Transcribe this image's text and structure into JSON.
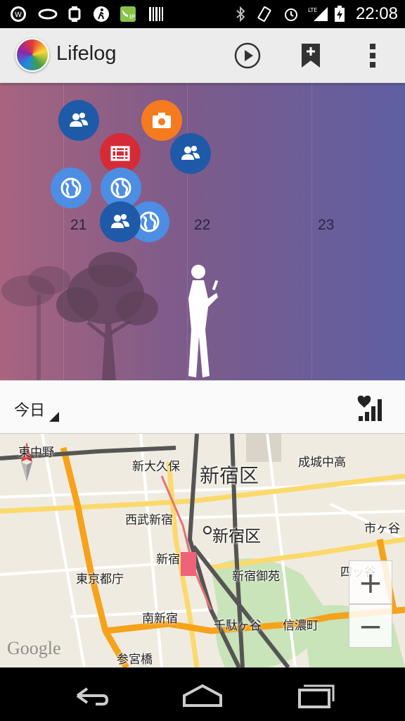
{
  "status_bar": {
    "time": "22:08",
    "left_icons": [
      "w-badge-icon",
      "wristband-icon",
      "smartwatch-icon",
      "walking-person-icon",
      "ip-phone-icon",
      "barcode-icon"
    ],
    "right_icons": [
      "bluetooth-icon",
      "vibrate-icon",
      "alarm-icon",
      "lte-signal-icon",
      "battery-charging-icon"
    ]
  },
  "action_bar": {
    "title": "Lifelog",
    "actions": [
      "play-icon",
      "add-bookmark-icon",
      "overflow-menu-icon"
    ]
  },
  "timeline": {
    "days": [
      "21",
      "22",
      "23"
    ],
    "bubbles": [
      {
        "icon": "people-icon",
        "color": "#1f5aa8"
      },
      {
        "icon": "camera-icon",
        "color": "#f47b20"
      },
      {
        "icon": "movie-icon",
        "color": "#d52b37"
      },
      {
        "icon": "people-icon",
        "color": "#1f5aa8"
      },
      {
        "icon": "globe-icon",
        "color": "#4c8ee3"
      },
      {
        "icon": "globe-icon",
        "color": "#4c8ee3"
      },
      {
        "icon": "globe-icon",
        "color": "#4c8ee3"
      },
      {
        "icon": "people-icon",
        "color": "#1f5aa8"
      }
    ]
  },
  "filter_bar": {
    "period_label": "今日",
    "stats_icon": "heart-signal-icon"
  },
  "map": {
    "labels": {
      "higashi_nakano": "東中野",
      "shin_okubo": "新大久保",
      "shinjuku_ward_big": "新宿区",
      "seijo_chuko": "成城中高",
      "seibu_shinjuku": "西武新宿",
      "shinjuku_ward": "新宿区",
      "ichigaya": "市ヶ谷",
      "shinjuku": "新宿",
      "shinjuku_gyoen": "新宿御苑",
      "yotsuya": "四ッ谷",
      "tokyo_tocho": "東京都庁",
      "minami_shinjuku": "南新宿",
      "sendagaya": "千駄ヶ谷",
      "shinanomachi": "信濃町",
      "sangubashi": "参宮橋"
    },
    "zoom_in": "+",
    "zoom_out": "−",
    "attribution": "Google"
  },
  "nav_bar": [
    "back-icon",
    "home-icon",
    "recent-apps-icon"
  ]
}
